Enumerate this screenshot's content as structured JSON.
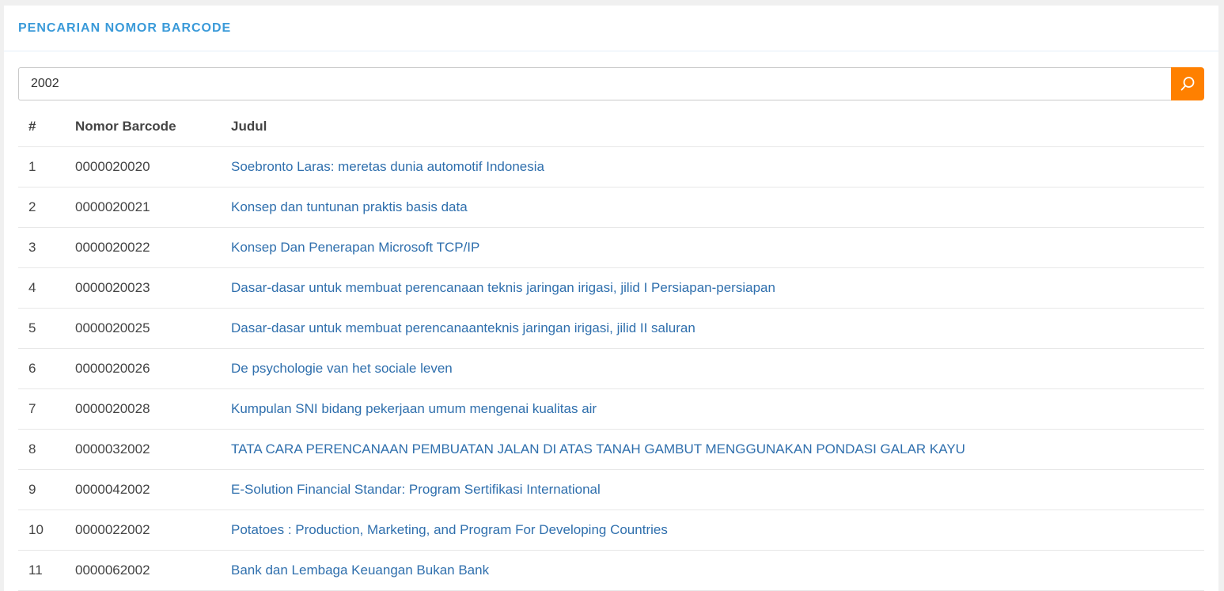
{
  "panel": {
    "title": "PENCARIAN NOMOR BARCODE"
  },
  "search": {
    "value": "2002",
    "button_icon": "search-icon"
  },
  "colors": {
    "accent": "#3a9ad9",
    "button": "#ff8000",
    "link": "#2f6fad"
  },
  "table": {
    "headers": {
      "num": "#",
      "barcode": "Nomor Barcode",
      "title": "Judul"
    },
    "rows": [
      {
        "num": "1",
        "barcode": "0000020020",
        "title": "Soebronto Laras: meretas dunia automotif Indonesia"
      },
      {
        "num": "2",
        "barcode": "0000020021",
        "title": "Konsep dan tuntunan praktis basis data"
      },
      {
        "num": "3",
        "barcode": "0000020022",
        "title": "Konsep Dan Penerapan Microsoft TCP/IP"
      },
      {
        "num": "4",
        "barcode": "0000020023",
        "title": "Dasar-dasar untuk membuat perencanaan teknis jaringan irigasi, jilid I Persiapan-persiapan"
      },
      {
        "num": "5",
        "barcode": "0000020025",
        "title": "Dasar-dasar untuk membuat perencanaanteknis jaringan irigasi, jilid II saluran"
      },
      {
        "num": "6",
        "barcode": "0000020026",
        "title": "De psychologie van het sociale leven"
      },
      {
        "num": "7",
        "barcode": "0000020028",
        "title": "Kumpulan SNI bidang pekerjaan umum mengenai kualitas air"
      },
      {
        "num": "8",
        "barcode": "0000032002",
        "title": "TATA CARA PERENCANAAN PEMBUATAN JALAN DI ATAS TANAH GAMBUT MENGGUNAKAN PONDASI GALAR KAYU"
      },
      {
        "num": "9",
        "barcode": "0000042002",
        "title": "E-Solution Financial Standar: Program Sertifikasi International"
      },
      {
        "num": "10",
        "barcode": "0000022002",
        "title": "Potatoes : Production, Marketing, and Program For Developing Countries"
      },
      {
        "num": "11",
        "barcode": "0000062002",
        "title": "Bank dan Lembaga Keuangan Bukan Bank"
      }
    ]
  }
}
